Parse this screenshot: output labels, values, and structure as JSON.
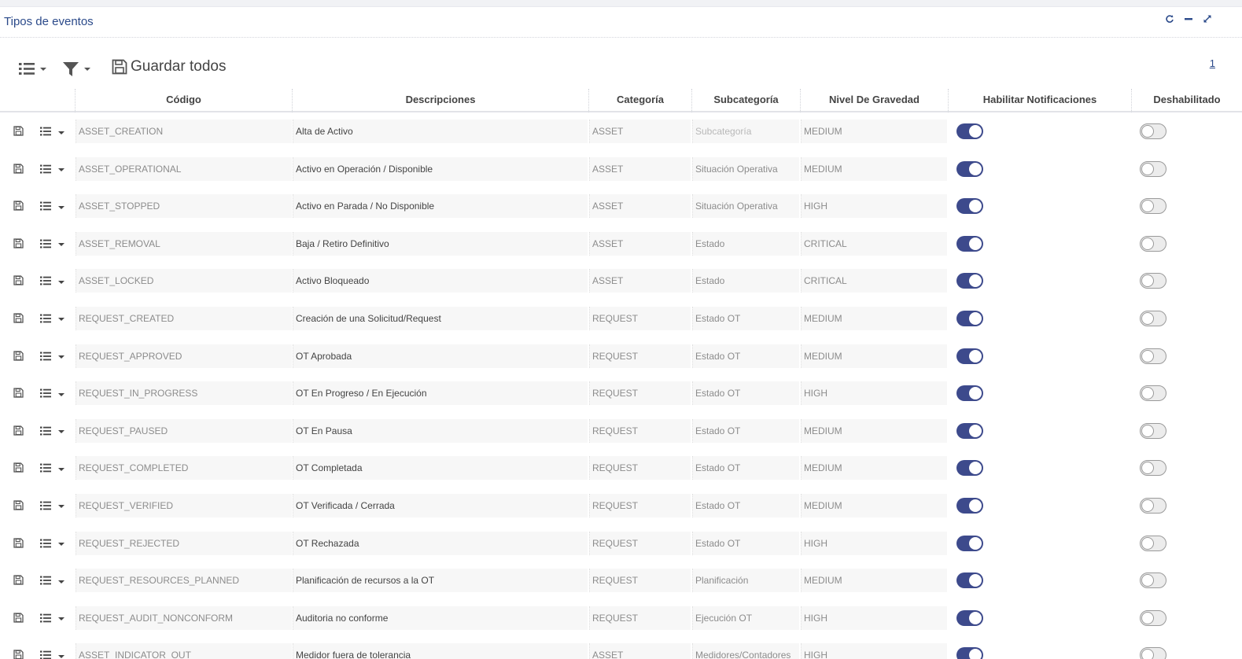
{
  "portlet": {
    "title": "Tipos de eventos",
    "tools": [
      "refresh-icon",
      "minimize-icon",
      "expand-icon"
    ]
  },
  "toolbar": {
    "save_all_label": "Guardar todos",
    "pager_label": "1"
  },
  "columns": [
    "Código",
    "Descripciones",
    "Categoría",
    "Subcategoría",
    "Nivel De Gravedad",
    "Habilitar Notificaciones",
    "Deshabilitado"
  ],
  "rows": [
    {
      "code": "ASSET_CREATION",
      "description": "Alta de Activo",
      "category": "ASSET",
      "subcategory": "Subcategoría",
      "subcategory_is_placeholder": true,
      "severity": "MEDIUM",
      "notifications": true,
      "disabled": false
    },
    {
      "code": "ASSET_OPERATIONAL",
      "description": "Activo en Operación / Disponible",
      "category": "ASSET",
      "subcategory": "Situación Operativa",
      "severity": "MEDIUM",
      "notifications": true,
      "disabled": false
    },
    {
      "code": "ASSET_STOPPED",
      "description": "Activo en Parada / No Disponible",
      "category": "ASSET",
      "subcategory": "Situación Operativa",
      "severity": "HIGH",
      "notifications": true,
      "disabled": false
    },
    {
      "code": "ASSET_REMOVAL",
      "description": "Baja / Retiro Definitivo",
      "category": "ASSET",
      "subcategory": "Estado",
      "severity": "CRITICAL",
      "notifications": true,
      "disabled": false
    },
    {
      "code": "ASSET_LOCKED",
      "description": "Activo Bloqueado",
      "category": "ASSET",
      "subcategory": "Estado",
      "severity": "CRITICAL",
      "notifications": true,
      "disabled": false
    },
    {
      "code": "REQUEST_CREATED",
      "description": "Creación de una Solicitud/Request",
      "category": "REQUEST",
      "subcategory": "Estado OT",
      "severity": "MEDIUM",
      "notifications": true,
      "disabled": false
    },
    {
      "code": "REQUEST_APPROVED",
      "description": "OT Aprobada",
      "category": "REQUEST",
      "subcategory": "Estado OT",
      "severity": "MEDIUM",
      "notifications": true,
      "disabled": false
    },
    {
      "code": "REQUEST_IN_PROGRESS",
      "description": "OT En Progreso / En Ejecución",
      "category": "REQUEST",
      "subcategory": "Estado OT",
      "severity": "HIGH",
      "notifications": true,
      "disabled": false
    },
    {
      "code": "REQUEST_PAUSED",
      "description": "OT En Pausa",
      "category": "REQUEST",
      "subcategory": "Estado OT",
      "severity": "MEDIUM",
      "notifications": true,
      "disabled": false
    },
    {
      "code": "REQUEST_COMPLETED",
      "description": "OT Completada",
      "category": "REQUEST",
      "subcategory": "Estado OT",
      "severity": "MEDIUM",
      "notifications": true,
      "disabled": false
    },
    {
      "code": "REQUEST_VERIFIED",
      "description": "OT Verificada / Cerrada",
      "category": "REQUEST",
      "subcategory": "Estado OT",
      "severity": "MEDIUM",
      "notifications": true,
      "disabled": false
    },
    {
      "code": "REQUEST_REJECTED",
      "description": "OT Rechazada",
      "category": "REQUEST",
      "subcategory": "Estado OT",
      "severity": "HIGH",
      "notifications": true,
      "disabled": false
    },
    {
      "code": "REQUEST_RESOURCES_PLANNED",
      "description": "Planificación de recursos a la OT",
      "category": "REQUEST",
      "subcategory": "Planificación",
      "severity": "MEDIUM",
      "notifications": true,
      "disabled": false
    },
    {
      "code": "REQUEST_AUDIT_NONCONFORM",
      "description": "Auditoria no conforme",
      "category": "REQUEST",
      "subcategory": "Ejecución OT",
      "severity": "HIGH",
      "notifications": true,
      "disabled": false
    },
    {
      "code": "ASSET_INDICATOR_OUT",
      "description": "Medidor fuera de tolerancia",
      "category": "ASSET",
      "subcategory": "Medidores/Contadores",
      "severity": "HIGH",
      "notifications": true,
      "disabled": false
    }
  ],
  "colors": {
    "accent": "#2b4a8a",
    "toggle_on": "#3d4a8c"
  }
}
